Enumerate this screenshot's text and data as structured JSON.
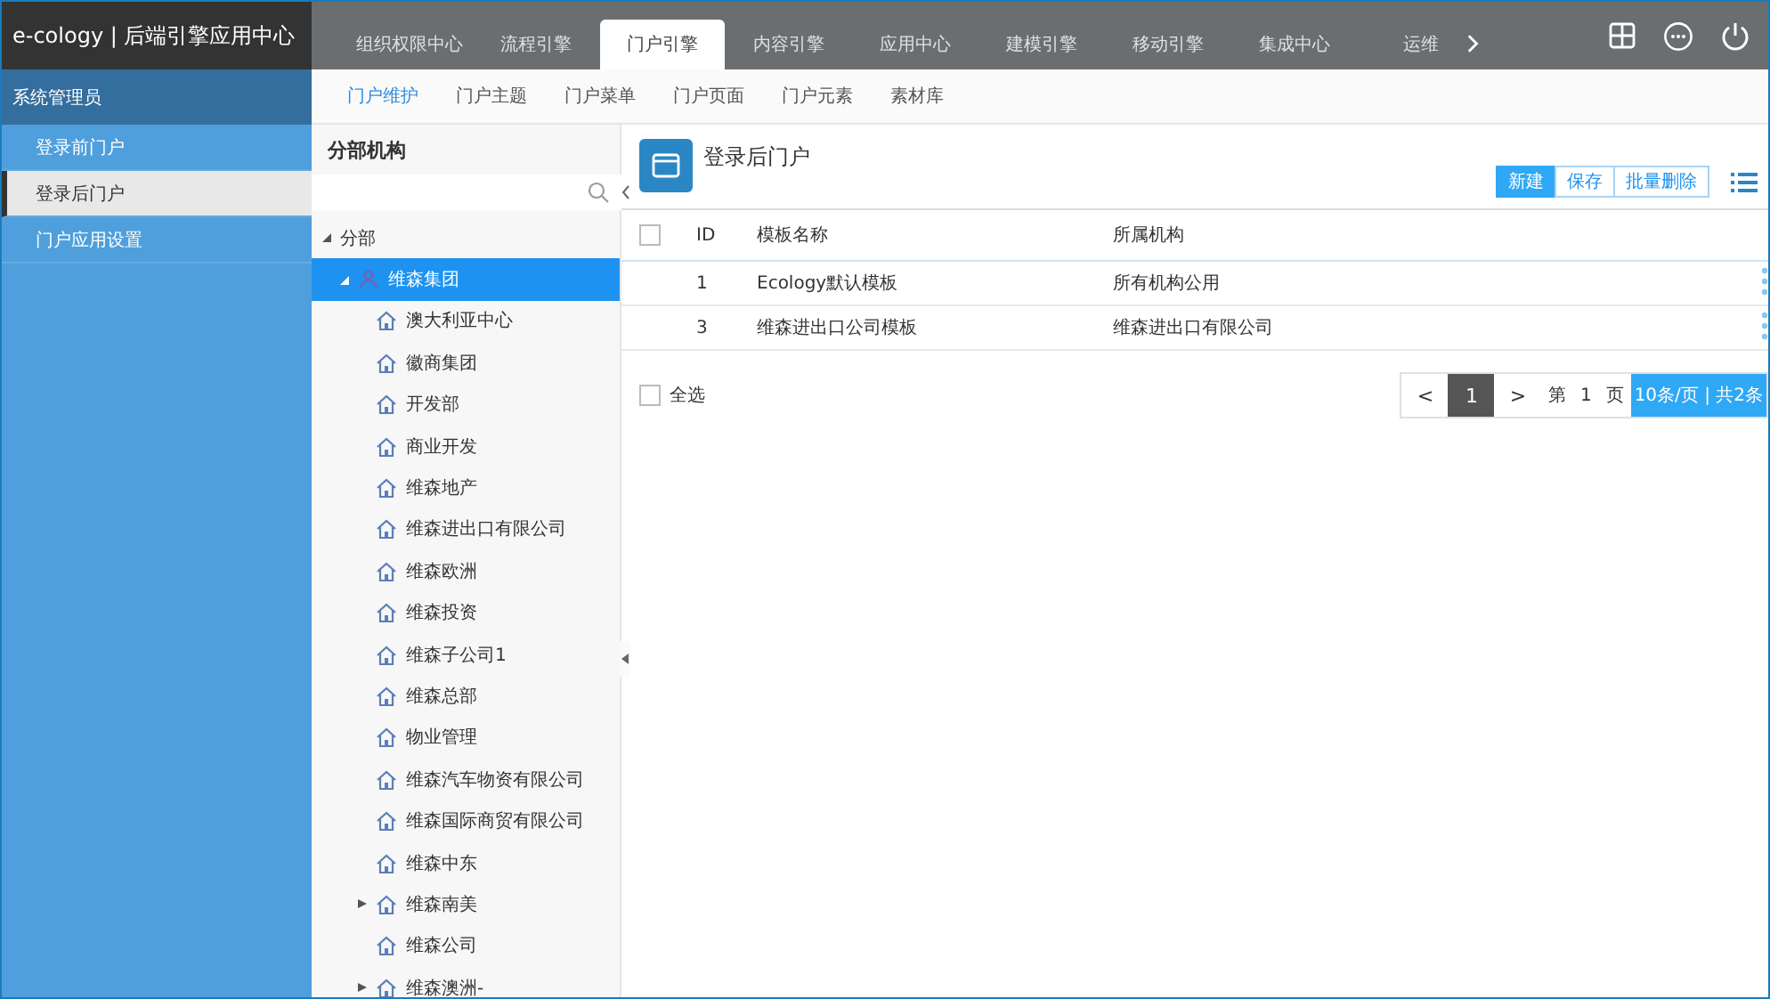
{
  "app_title": "e-cology | 后端引擎应用中心",
  "top_tabs": [
    {
      "label": "组织权限中心",
      "selected": false
    },
    {
      "label": "流程引擎",
      "selected": false
    },
    {
      "label": "门户引擎",
      "selected": true
    },
    {
      "label": "内容引擎",
      "selected": false
    },
    {
      "label": "应用中心",
      "selected": false
    },
    {
      "label": "建模引擎",
      "selected": false
    },
    {
      "label": "移动引擎",
      "selected": false
    },
    {
      "label": "集成中心",
      "selected": false
    },
    {
      "label": "运维",
      "selected": false
    }
  ],
  "sidebar": {
    "header": "系统管理员",
    "items": [
      {
        "label": "登录前门户",
        "selected": false
      },
      {
        "label": "登录后门户",
        "selected": true
      },
      {
        "label": "门户应用设置",
        "selected": false
      }
    ]
  },
  "sub_tabs": [
    {
      "label": "门户维护",
      "selected": true
    },
    {
      "label": "门户主题",
      "selected": false
    },
    {
      "label": "门户菜单",
      "selected": false
    },
    {
      "label": "门户页面",
      "selected": false
    },
    {
      "label": "门户元素",
      "selected": false
    },
    {
      "label": "素材库",
      "selected": false
    }
  ],
  "tree": {
    "title": "分部机构",
    "items": [
      {
        "label": "分部",
        "expanded": true,
        "selected": false,
        "children": [
          {
            "label": "维森集团",
            "kind": "group",
            "expanded": true,
            "selected": true,
            "children": [
              {
                "label": "澳大利亚中心",
                "kind": "branch",
                "selected": false
              },
              {
                "label": "徽商集团",
                "kind": "branch",
                "selected": false
              },
              {
                "label": "开发部",
                "kind": "branch",
                "selected": false
              },
              {
                "label": "商业开发",
                "kind": "branch",
                "selected": false
              },
              {
                "label": "维森地产",
                "kind": "branch",
                "selected": false
              },
              {
                "label": "维森进出口有限公司",
                "kind": "branch",
                "selected": false
              },
              {
                "label": "维森欧洲",
                "kind": "branch",
                "selected": false
              },
              {
                "label": "维森投资",
                "kind": "branch",
                "selected": false
              },
              {
                "label": "维森子公司1",
                "kind": "branch",
                "selected": false
              },
              {
                "label": "维森总部",
                "kind": "branch",
                "selected": false
              },
              {
                "label": "物业管理",
                "kind": "branch",
                "selected": false
              },
              {
                "label": "维森汽车物资有限公司",
                "kind": "branch",
                "selected": false
              },
              {
                "label": "维森国际商贸有限公司",
                "kind": "branch",
                "selected": false
              },
              {
                "label": "维森中东",
                "kind": "branch",
                "selected": false
              },
              {
                "label": "维森南美",
                "kind": "branch",
                "expanded": false,
                "selected": false
              },
              {
                "label": "维森公司",
                "kind": "branch",
                "selected": false
              },
              {
                "label": "维森澳洲-",
                "kind": "branch",
                "expanded": false,
                "selected": false
              }
            ]
          }
        ]
      }
    ]
  },
  "page": {
    "title": "登录后门户",
    "buttons": [
      {
        "label": "新建",
        "primary": true
      },
      {
        "label": "保存",
        "primary": false
      },
      {
        "label": "批量删除",
        "primary": false
      }
    ],
    "table": {
      "header_checked": false,
      "columns": [
        "ID",
        "模板名称",
        "所属机构"
      ],
      "rows": [
        {
          "cells": [
            "1",
            "Ecology默认模板",
            "所有机构公用"
          ]
        },
        {
          "cells": [
            "3",
            "维森进出口公司模板",
            "维森进出口有限公司"
          ]
        }
      ]
    },
    "select_all": {
      "label": "全选",
      "checked": false
    },
    "pagination": {
      "prev": "<",
      "pages": [
        {
          "label": "1",
          "selected": true
        }
      ],
      "next": ">",
      "goto_prefix": "第",
      "goto_value": "1",
      "goto_suffix": "页",
      "summary": "10条/页 | 共2条"
    }
  }
}
